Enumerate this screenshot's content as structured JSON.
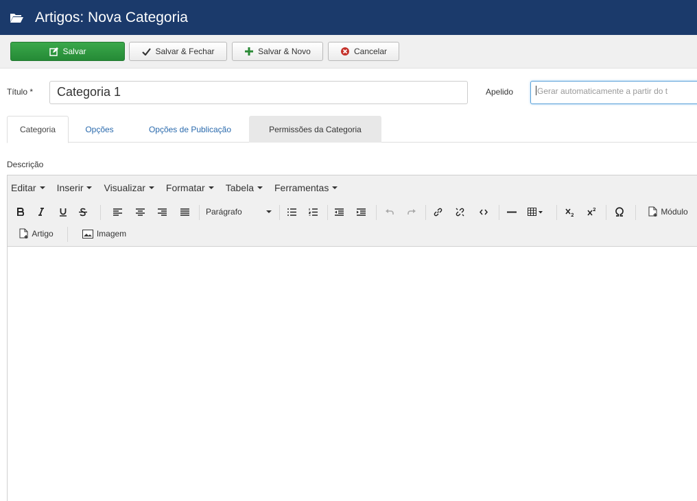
{
  "header": {
    "title": "Artigos: Nova Categoria",
    "icon": "folder-open-icon",
    "background": "#1b3a6b"
  },
  "toolbar": {
    "save_label": "Salvar",
    "save_close_label": "Salvar & Fechar",
    "save_new_label": "Salvar & Novo",
    "cancel_label": "Cancelar",
    "save_color": "#2f9a40"
  },
  "form": {
    "title_label": "Título *",
    "title_value": "Categoria 1",
    "alias_label": "Apelido",
    "alias_placeholder": "Gerar automaticamente a partir do t"
  },
  "tabs": [
    {
      "label": "Categoria",
      "active": true
    },
    {
      "label": "Opções",
      "active": false
    },
    {
      "label": "Opções de Publicação",
      "active": false
    },
    {
      "label": "Permissões da Categoria",
      "active": false
    }
  ],
  "description_label": "Descrição",
  "editor": {
    "menus": [
      "Editar",
      "Inserir",
      "Visualizar",
      "Formatar",
      "Tabela",
      "Ferramentas"
    ],
    "format_select": "Parágrafo",
    "module_label": "Módulo",
    "article_label": "Artigo",
    "image_label": "Imagem"
  }
}
